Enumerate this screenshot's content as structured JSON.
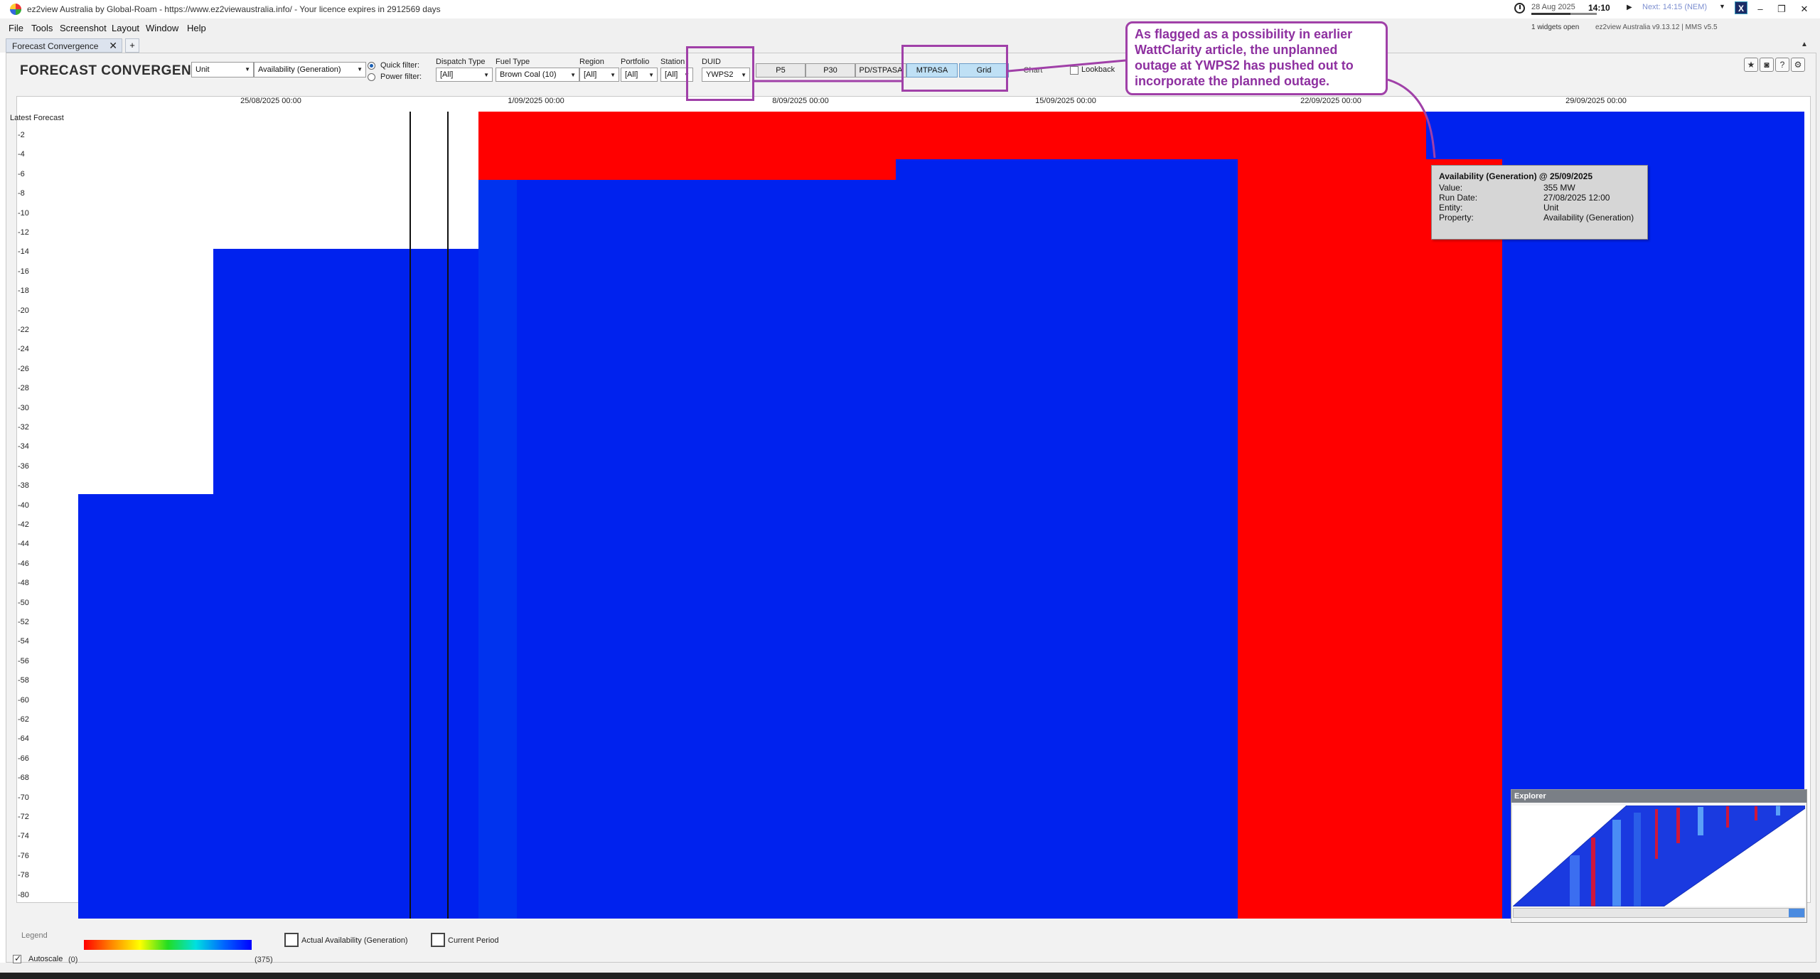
{
  "window": {
    "title": "ez2view Australia by Global-Roam - https://www.ez2viewaustralia.info/ - Your licence expires in 2912569 days",
    "date": "28 Aug 2025",
    "time": "14:10",
    "next": "Next: 14:15 (NEM)",
    "widgets_open": "1 widgets open",
    "version": "ez2view Australia v9.13.12 | MMS v5.5",
    "brand_icon": "ez2view-logo",
    "progress_fraction": 0.6
  },
  "menu": [
    "File",
    "Tools",
    "Screenshot",
    "Layout",
    "Window",
    "Help"
  ],
  "tabs": {
    "active": "Forecast Convergence",
    "add": "+"
  },
  "widget": {
    "title": "FORECAST CONVERGENCE",
    "entity_select": "Unit",
    "property_select": "Availability (Generation)",
    "quick_filter": "Quick filter:",
    "power_filter": "Power filter:",
    "filters": {
      "dispatch_type": {
        "label": "Dispatch Type",
        "value": "[All]"
      },
      "fuel_type": {
        "label": "Fuel Type",
        "value": "Brown Coal (10)"
      },
      "region": {
        "label": "Region",
        "value": "[All]"
      },
      "portfolio": {
        "label": "Portfolio",
        "value": "[All]"
      },
      "station": {
        "label": "Station",
        "value": "[All]"
      },
      "duid": {
        "label": "DUID",
        "value": "YWPS2"
      }
    },
    "modes": [
      "P5",
      "P30",
      "PD/STPASA",
      "MTPASA"
    ],
    "selected_mode": "MTPASA",
    "views": [
      "Grid",
      "Chart"
    ],
    "selected_view": "Grid",
    "lookback": "Lookback"
  },
  "grid": {
    "y_title": "Latest Forecast",
    "y_ticks": [
      "-2",
      "-4",
      "-6",
      "-8",
      "-10",
      "-12",
      "-14",
      "-16",
      "-18",
      "-20",
      "-22",
      "-24",
      "-26",
      "-28",
      "-30",
      "-32",
      "-34",
      "-36",
      "-38",
      "-40",
      "-42",
      "-44",
      "-46",
      "-48",
      "-50",
      "-52",
      "-54",
      "-56",
      "-58",
      "-60",
      "-62",
      "-64",
      "-66",
      "-68",
      "-70",
      "-72",
      "-74",
      "-76",
      "-78",
      "-80"
    ],
    "x_ticks": [
      "25/08/2025 00:00",
      "1/09/2025 00:00",
      "8/09/2025 00:00",
      "15/09/2025 00:00",
      "22/09/2025 00:00",
      "29/09/2025 00:00"
    ],
    "colors": {
      "available": "#0022ee",
      "outage": "#ff0000",
      "no_data": "#ffffff"
    }
  },
  "tooltip": {
    "title": "Availability (Generation) @ 25/09/2025",
    "rows": [
      {
        "key": "Value:",
        "val": "355 MW"
      },
      {
        "key": "Run Date:",
        "val": "27/08/2025 12:00"
      },
      {
        "key": "Entity:",
        "val": "Unit"
      },
      {
        "key": "Property:",
        "val": "Availability (Generation)"
      }
    ]
  },
  "annotation": {
    "text": "As flagged as a possibility in earlier WattClarity article, the unplanned outage at YWPS2 has pushed out to incorporate the planned outage."
  },
  "explorer": {
    "title": "Explorer"
  },
  "legend": {
    "title": "Legend",
    "min": "(0)",
    "max": "(375)",
    "autoscale": "Autoscale",
    "actual": "Actual Availability (Generation)",
    "current": "Current Period"
  }
}
